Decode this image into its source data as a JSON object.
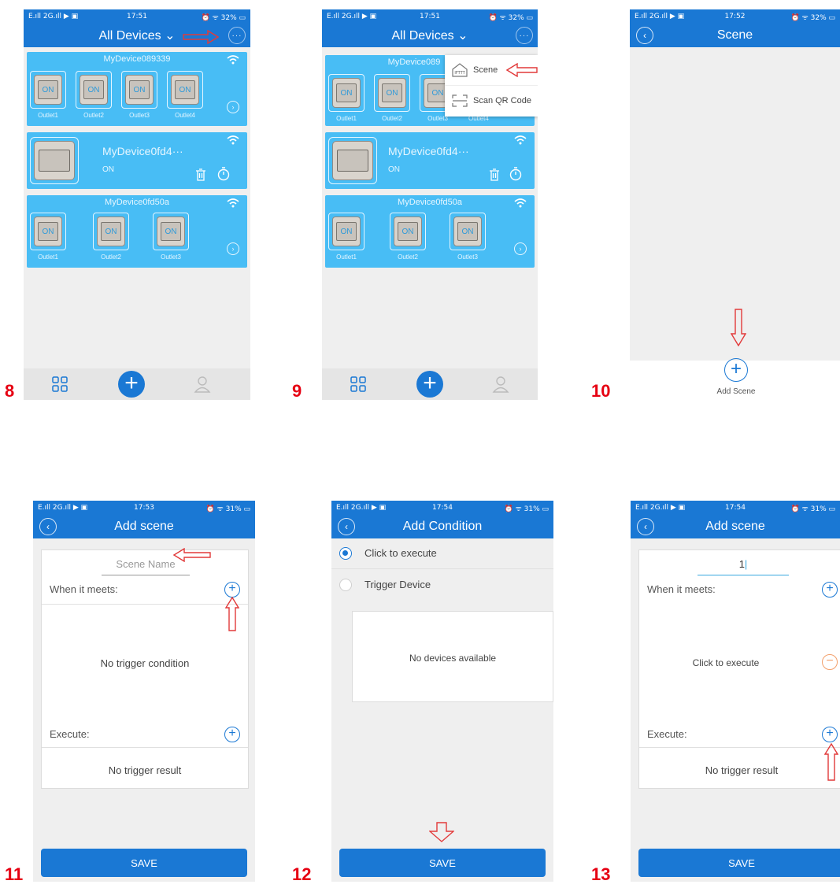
{
  "status": {
    "left": "E.ıll 2G.ıll ▶ ▣",
    "right": "⏰ ᯤ 32% ▭",
    "right31": "⏰ ᯤ 31% ▭"
  },
  "steps": [
    "8",
    "9",
    "10",
    "11",
    "12",
    "13"
  ],
  "s8": {
    "time": "17:51",
    "title": "All Devices",
    "more": "···",
    "dev1": {
      "name": "MyDevice089339",
      "outlets": [
        "Outlet1",
        "Outlet2",
        "Outlet3",
        "Outlet4"
      ],
      "on": "ON"
    },
    "dev2": {
      "name": "MyDevice0fd4···",
      "state": "ON"
    },
    "dev3": {
      "name": "MyDevice0fd50a",
      "outlets": [
        "Outlet1",
        "Outlet2",
        "Outlet3"
      ],
      "on": "ON"
    }
  },
  "s9": {
    "time": "17:51",
    "title": "All Devices",
    "more": "···",
    "dev1": {
      "name": "MyDevice089",
      "outlets": [
        "Outlet1",
        "Outlet2",
        "Outlet3",
        "Outlet4"
      ],
      "on": "ON"
    },
    "dev2": {
      "name": "MyDevice0fd4···",
      "state": "ON"
    },
    "dev3": {
      "name": "MyDevice0fd50a",
      "outlets": [
        "Outlet1",
        "Outlet2",
        "Outlet3"
      ],
      "on": "ON"
    },
    "menu": {
      "scene": "Scene",
      "ifttt": "IFTTT",
      "scan": "Scan QR Code"
    }
  },
  "s10": {
    "time": "17:52",
    "title": "Scene",
    "add_label": "Add Scene"
  },
  "s11": {
    "time": "17:53",
    "title": "Add scene",
    "placeholder": "Scene Name",
    "when": "When it meets:",
    "no_trigger": "No trigger condition",
    "execute": "Execute:",
    "no_result": "No trigger result",
    "save": "SAVE"
  },
  "s12": {
    "time": "17:54",
    "title": "Add Condition",
    "opt1": "Click to execute",
    "opt2": "Trigger Device",
    "no_devices": "No devices available",
    "save": "SAVE"
  },
  "s13": {
    "time": "17:54",
    "title": "Add scene",
    "name_value": "1",
    "when": "When it meets:",
    "click_exec": "Click to execute",
    "execute": "Execute:",
    "no_result": "No trigger result",
    "save": "SAVE"
  }
}
